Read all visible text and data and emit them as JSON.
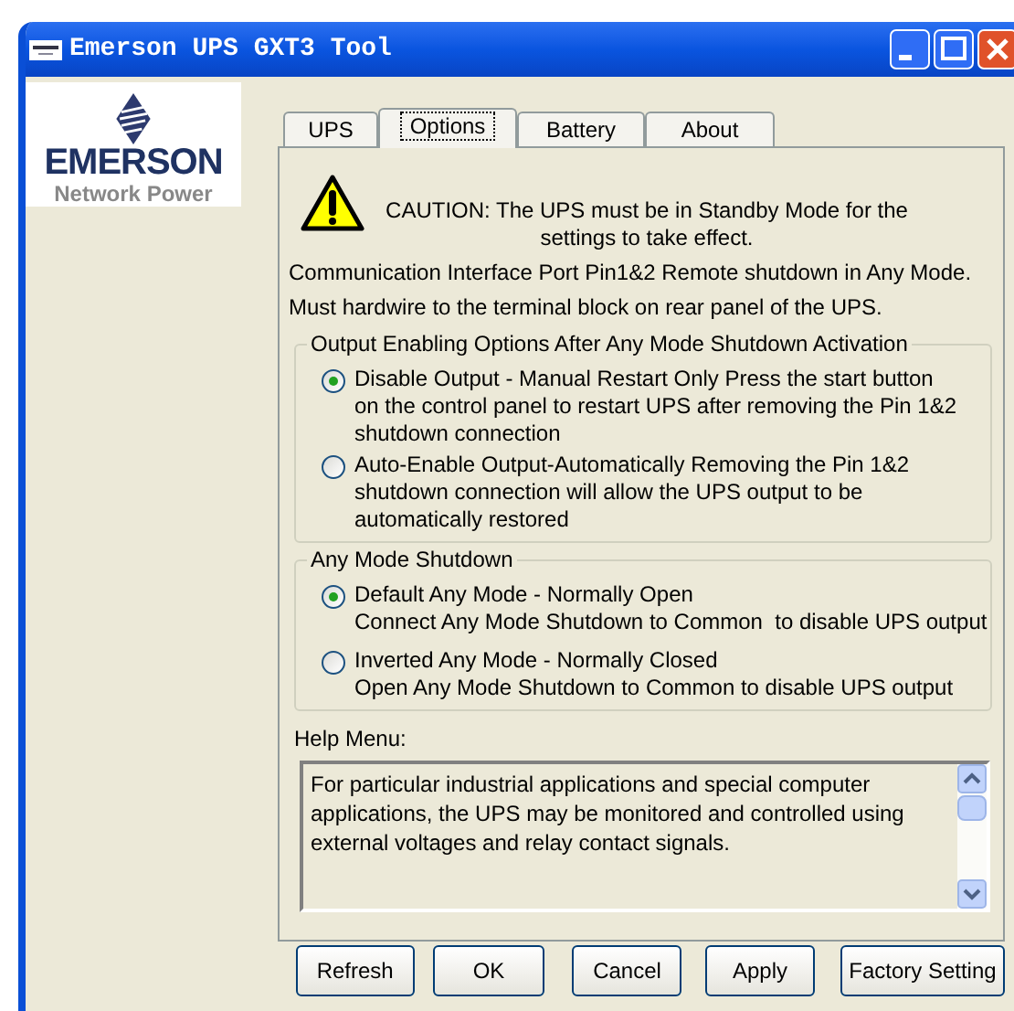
{
  "window": {
    "title": "Emerson UPS GXT3 Tool"
  },
  "logo": {
    "brand": "EMERSON",
    "subtitle": "Network Power"
  },
  "tabs": [
    {
      "label": "UPS",
      "selected": false
    },
    {
      "label": "Options",
      "selected": true
    },
    {
      "label": "Battery",
      "selected": false
    },
    {
      "label": "About",
      "selected": false
    }
  ],
  "caution": {
    "lines": [
      "CAUTION: The UPS must be in Standby Mode for the",
      "settings to take effect."
    ]
  },
  "notes": [
    "Communication Interface Port Pin1&2 Remote shutdown in Any Mode.",
    "Must hardwire to the terminal block on rear panel of the UPS."
  ],
  "groups": [
    {
      "title": "Output Enabling Options After Any Mode Shutdown Activation",
      "options": [
        {
          "lines": [
            "Disable Output - Manual Restart Only Press the start button",
            "on the control panel to restart UPS after removing the Pin 1&2",
            "shutdown connection"
          ],
          "selected": true
        },
        {
          "lines": [
            "Auto-Enable Output-Automatically Removing the Pin 1&2",
            "shutdown connection will allow the UPS output to be",
            "automatically restored"
          ],
          "selected": false
        }
      ]
    },
    {
      "title": "Any Mode Shutdown",
      "options": [
        {
          "lines": [
            "Default Any Mode - Normally Open",
            "Connect Any Mode Shutdown to Common  to disable UPS output"
          ],
          "selected": true
        },
        {
          "lines": [
            "Inverted Any Mode - Normally Closed",
            "Open Any Mode Shutdown to Common to disable UPS output"
          ],
          "selected": false
        }
      ]
    }
  ],
  "help": {
    "label": "Help Menu:",
    "text": "For particular industrial applications and special computer applications, the UPS may be monitored and controlled using external voltages and relay contact signals."
  },
  "buttons": [
    "Refresh",
    "OK",
    "Cancel",
    "Apply",
    "Factory Setting"
  ]
}
